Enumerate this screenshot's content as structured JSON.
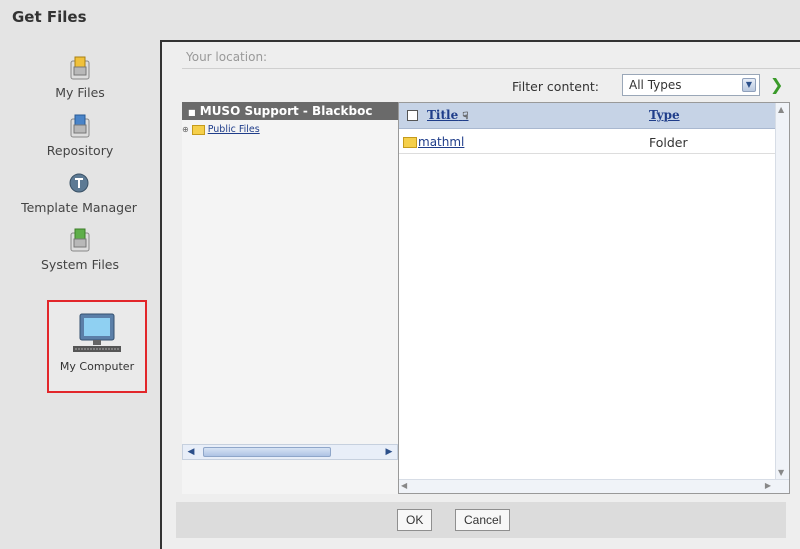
{
  "page": {
    "title": "Get Files"
  },
  "nav": {
    "items": [
      {
        "label": "My Files"
      },
      {
        "label": "Repository"
      },
      {
        "label": "Template Manager"
      },
      {
        "label": "System Files"
      },
      {
        "label": "My Computer"
      }
    ]
  },
  "dialog": {
    "location_label": "Your location:",
    "filter_label": "Filter content:",
    "filter_value": "All Types",
    "tree": {
      "header": "MUSO Support - Blackboc",
      "items": [
        {
          "label": "Public Files"
        }
      ]
    },
    "list": {
      "columns": {
        "title": "Title",
        "type": "Type"
      },
      "rows": [
        {
          "name": "mathml",
          "type": "Folder"
        }
      ]
    },
    "buttons": {
      "ok": "OK",
      "cancel": "Cancel"
    }
  },
  "colors": {
    "highlight_border": "#e2262a",
    "list_header_bg": "#c6d3e6",
    "link": "#1f3d8a"
  }
}
